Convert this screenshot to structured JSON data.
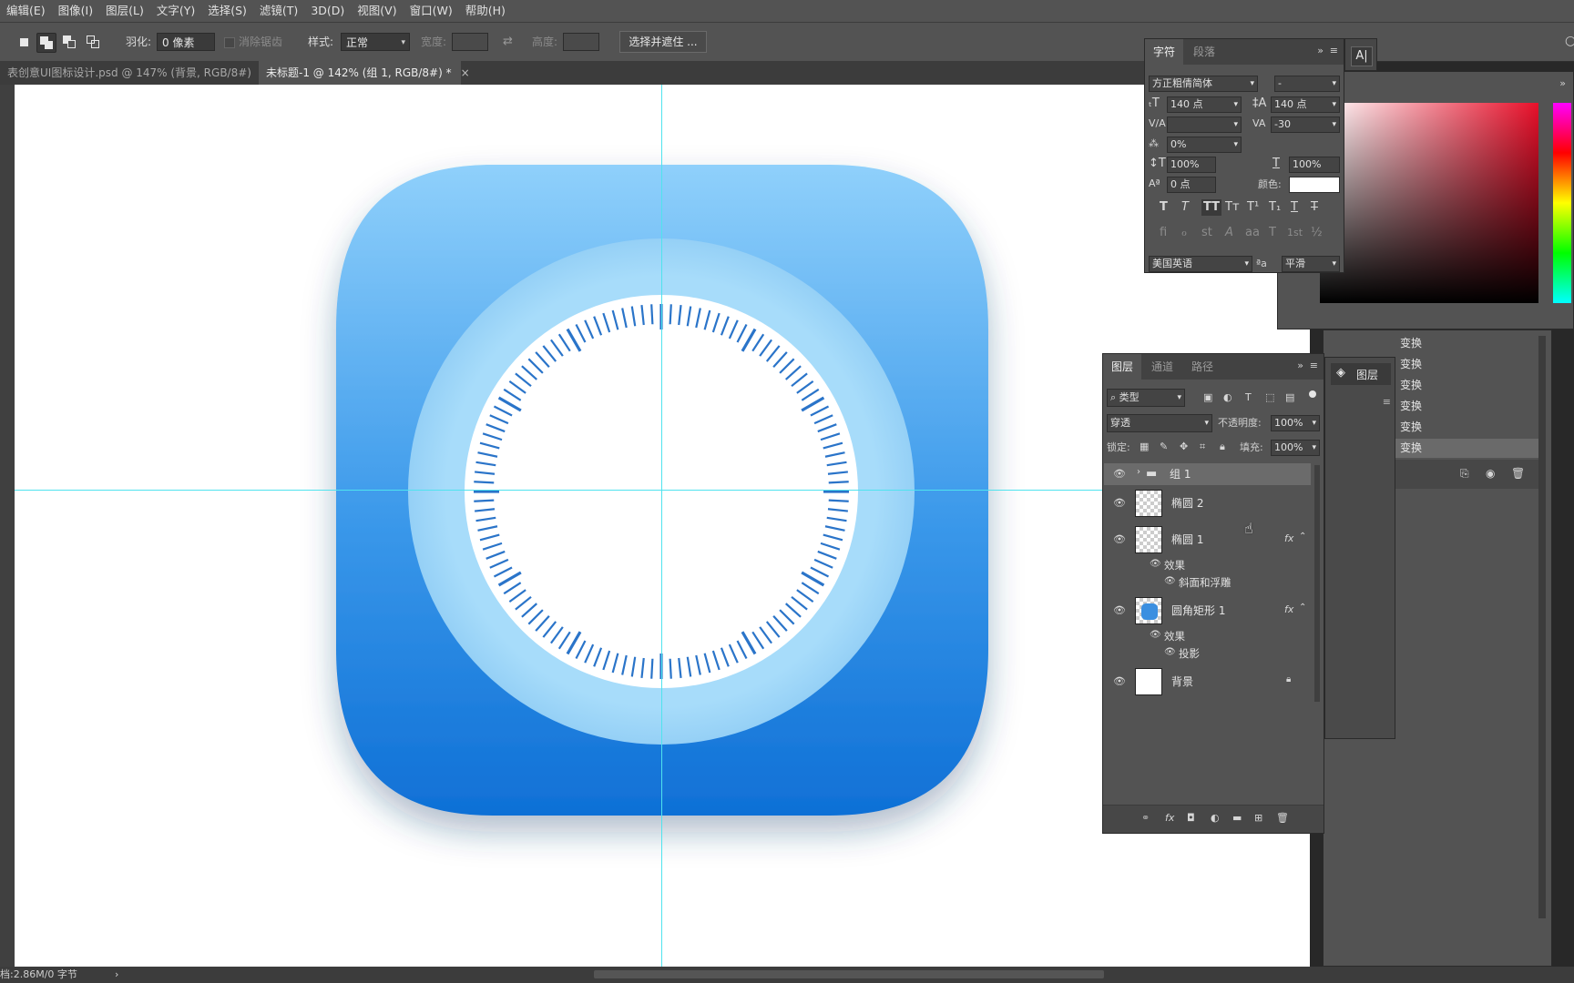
{
  "menu": [
    "编辑(E)",
    "图像(I)",
    "图层(L)",
    "文字(Y)",
    "选择(S)",
    "滤镜(T)",
    "3D(D)",
    "视图(V)",
    "窗口(W)",
    "帮助(H)"
  ],
  "options": {
    "feather_label": "羽化:",
    "feather_value": "0 像素",
    "antialias_label": "消除锯齿",
    "style_label": "样式:",
    "style_value": "正常",
    "width_label": "宽度:",
    "height_label": "高度:",
    "select_mask_button": "选择并遮住 ..."
  },
  "tabs": [
    {
      "label": "表创意UI图标设计.psd @ 147% (背景, RGB/8#)",
      "close": "×"
    },
    {
      "label": "未标题-1 @ 142% (组 1, RGB/8#) *",
      "close": "×"
    }
  ],
  "status": {
    "doc_size": "档:2.86M/0 字节",
    "arrow": "›"
  },
  "character_panel": {
    "tabs": [
      "字符",
      "段落"
    ],
    "font_family": "方正粗倩简体",
    "font_style": "-",
    "font_size": "140 点",
    "leading": "140 点",
    "kerning": "",
    "tracking": "-30",
    "scale_percent": "0%",
    "vertical_scale": "100%",
    "horizontal_scale": "100%",
    "baseline_shift": "0 点",
    "color_label": "颜色:",
    "color_value": "#ffffff",
    "language": "美国英语",
    "aa_label": "ªa",
    "antialias": "平滑",
    "style_buttons": [
      "T",
      "T",
      "TT",
      "Tт",
      "T¹",
      "T₁",
      "T",
      "T"
    ],
    "opentype_buttons": [
      "ﬁ",
      "ℴ",
      "st",
      "A",
      "aa",
      "T",
      "1st",
      "½"
    ]
  },
  "layers_panel": {
    "tabs": [
      "图层",
      "通道",
      "路径"
    ],
    "filter_label": "类型",
    "blend_mode": "穿透",
    "opacity_label": "不透明度:",
    "opacity_value": "100%",
    "lock_label": "锁定:",
    "fill_label": "填充:",
    "fill_value": "100%",
    "layers": [
      {
        "name": "组 1",
        "type": "group"
      },
      {
        "name": "椭圆 2",
        "type": "shape"
      },
      {
        "name": "椭圆 1",
        "type": "shape",
        "fx": "fx",
        "effects_label": "效果",
        "effects": [
          "斜面和浮雕"
        ]
      },
      {
        "name": "圆角矩形 1",
        "type": "shape",
        "fx": "fx",
        "effects_label": "效果",
        "effects": [
          "投影"
        ]
      },
      {
        "name": "背景",
        "type": "background"
      }
    ]
  },
  "mini_layers_label": "图层",
  "history": {
    "items": [
      "变换",
      "变换",
      "变换",
      "变换",
      "变换",
      "变换"
    ]
  },
  "colors": {
    "icon_top": "#8fd0fb",
    "icon_bottom": "#0f70d6",
    "ring": "#a5daf9",
    "ticks": "#2a74c9",
    "guide": "#4fe3ee"
  }
}
